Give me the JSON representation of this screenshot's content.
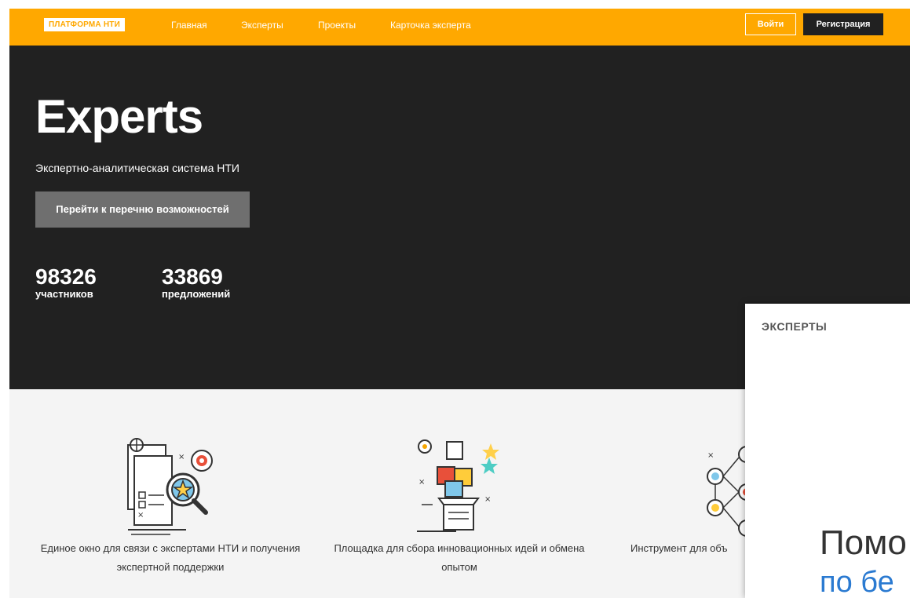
{
  "navbar": {
    "logo": "ПЛАТФОРМА НТИ",
    "links": [
      "Главная",
      "Эксперты",
      "Проекты",
      "Карточка эксперта"
    ],
    "login": "Войти",
    "register": "Регистрация"
  },
  "hero": {
    "title": "Experts",
    "subtitle": "Экспертно-аналитическая система НТИ",
    "button": "Перейти к перечню возможностей",
    "stats": [
      {
        "value": "98326",
        "label": "участников"
      },
      {
        "value": "33869",
        "label": "предложений"
      }
    ]
  },
  "features": [
    {
      "icon": "document-search-icon",
      "text": "Единое окно для связи с экспертами НТИ и получения экспертной поддержки"
    },
    {
      "icon": "puzzle-hat-icon",
      "text": "Площадка для сбора инновационных идей и обмена опытом"
    },
    {
      "icon": "network-icon",
      "text": "Инструмент для объ"
    }
  ],
  "overlay": {
    "label": "ЭКСПЕРТЫ",
    "heading": "Помо",
    "link": "по бе"
  },
  "colors": {
    "accent": "#ffa800",
    "dark": "#212121",
    "button_gray": "#6f6f6f",
    "link": "#2a7ad1"
  }
}
